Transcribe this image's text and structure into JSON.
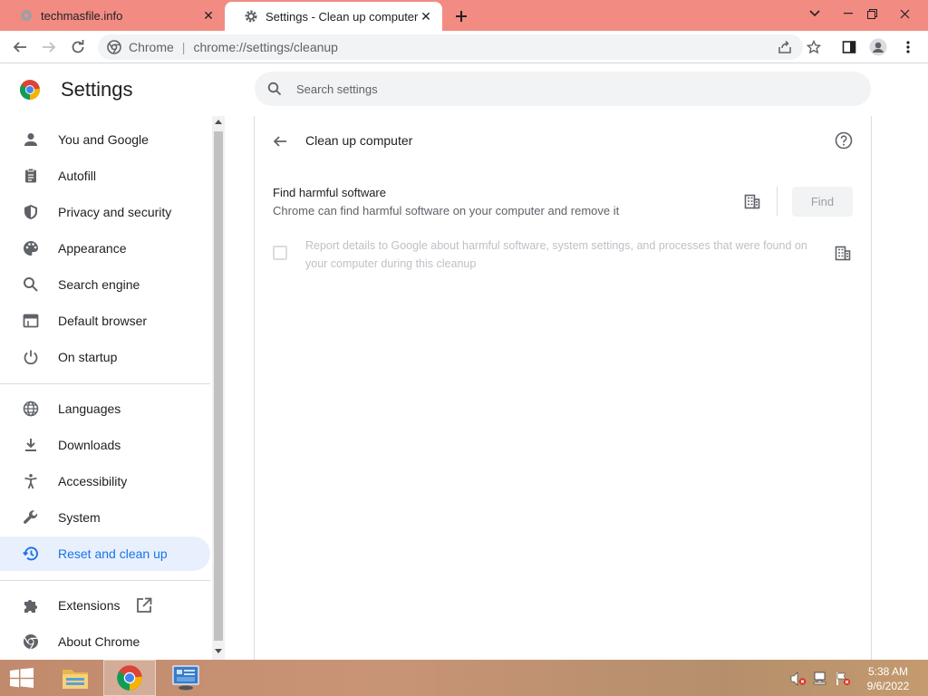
{
  "browser": {
    "tabs": [
      {
        "title": "techmasfile.info"
      },
      {
        "title": "Settings - Clean up computer"
      }
    ],
    "omnibox": {
      "site_label": "Chrome",
      "url": "chrome://settings/cleanup"
    }
  },
  "settings": {
    "title": "Settings",
    "search_placeholder": "Search settings",
    "nav": [
      {
        "label": "You and Google",
        "icon": "person-icon"
      },
      {
        "label": "Autofill",
        "icon": "clipboard-icon"
      },
      {
        "label": "Privacy and security",
        "icon": "shield-icon"
      },
      {
        "label": "Appearance",
        "icon": "palette-icon"
      },
      {
        "label": "Search engine",
        "icon": "search-icon"
      },
      {
        "label": "Default browser",
        "icon": "browser-window-icon"
      },
      {
        "label": "On startup",
        "icon": "power-icon"
      },
      {
        "label": "Languages",
        "icon": "globe-icon"
      },
      {
        "label": "Downloads",
        "icon": "download-icon"
      },
      {
        "label": "Accessibility",
        "icon": "accessibility-icon"
      },
      {
        "label": "System",
        "icon": "wrench-icon"
      },
      {
        "label": "Reset and clean up",
        "icon": "history-icon",
        "active": true
      },
      {
        "label": "Extensions",
        "icon": "puzzle-icon"
      },
      {
        "label": "About Chrome",
        "icon": "chrome-icon"
      }
    ]
  },
  "page": {
    "title": "Clean up computer",
    "find": {
      "title": "Find harmful software",
      "description": "Chrome can find harmful software on your computer and remove it",
      "button": "Find"
    },
    "report": {
      "text": "Report details to Google about harmful software, system settings, and processes that were found on your computer during this cleanup",
      "checked": false
    }
  },
  "taskbar": {
    "time": "5:38 AM",
    "date": "9/6/2022"
  },
  "colors": {
    "titlebar": "#f28b82",
    "accent": "#1a73e8",
    "active_nav_bg": "#e8f0fe"
  }
}
